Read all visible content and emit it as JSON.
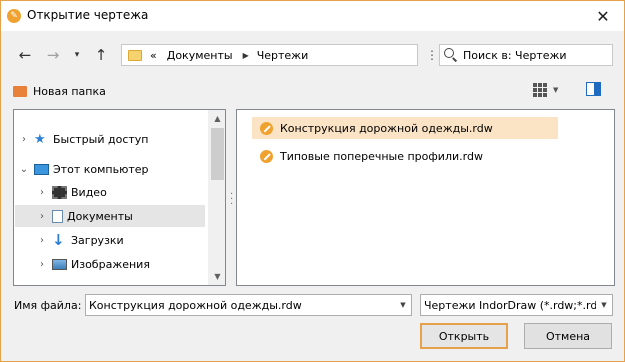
{
  "window": {
    "title": "Открытие чертежа",
    "accent_color": "#e6a24a",
    "close_icon": "close-icon"
  },
  "nav": {
    "back_icon": "←",
    "forward_icon": "→",
    "recent_icon": "▾",
    "up_icon": "↑",
    "breadcrumb": {
      "overflow": "«",
      "items": [
        "Документы",
        "Чертежи"
      ]
    },
    "search_placeholder": "Поиск в: Чертежи"
  },
  "toolbar": {
    "new_folder_label": "Новая папка",
    "view_icon": "grid-view-icon",
    "preview_icon": "preview-pane-icon"
  },
  "tree": {
    "items": [
      {
        "label": "Быстрый доступ",
        "icon": "star-icon",
        "level": 0,
        "expanded": false
      },
      {
        "label": "Этот компьютер",
        "icon": "computer-icon",
        "level": 0,
        "expanded": true
      },
      {
        "label": "Видео",
        "icon": "video-icon",
        "level": 1,
        "expanded": false
      },
      {
        "label": "Документы",
        "icon": "documents-icon",
        "level": 1,
        "expanded": false,
        "selected": true
      },
      {
        "label": "Загрузки",
        "icon": "download-icon",
        "level": 1,
        "expanded": false
      },
      {
        "label": "Изображения",
        "icon": "pictures-icon",
        "level": 1,
        "expanded": false
      }
    ]
  },
  "files": [
    {
      "name": "Конструкция дорожной одежды.rdw",
      "selected": true
    },
    {
      "name": "Типовые поперечные профили.rdw",
      "selected": false
    }
  ],
  "bottom": {
    "filename_label": "Имя файла:",
    "filename_value": "Конструкция дорожной одежды.rdw",
    "filter_value": "Чертежи IndorDraw (*.rdw;*.rdw",
    "open_label": "Открыть",
    "cancel_label": "Отмена"
  }
}
